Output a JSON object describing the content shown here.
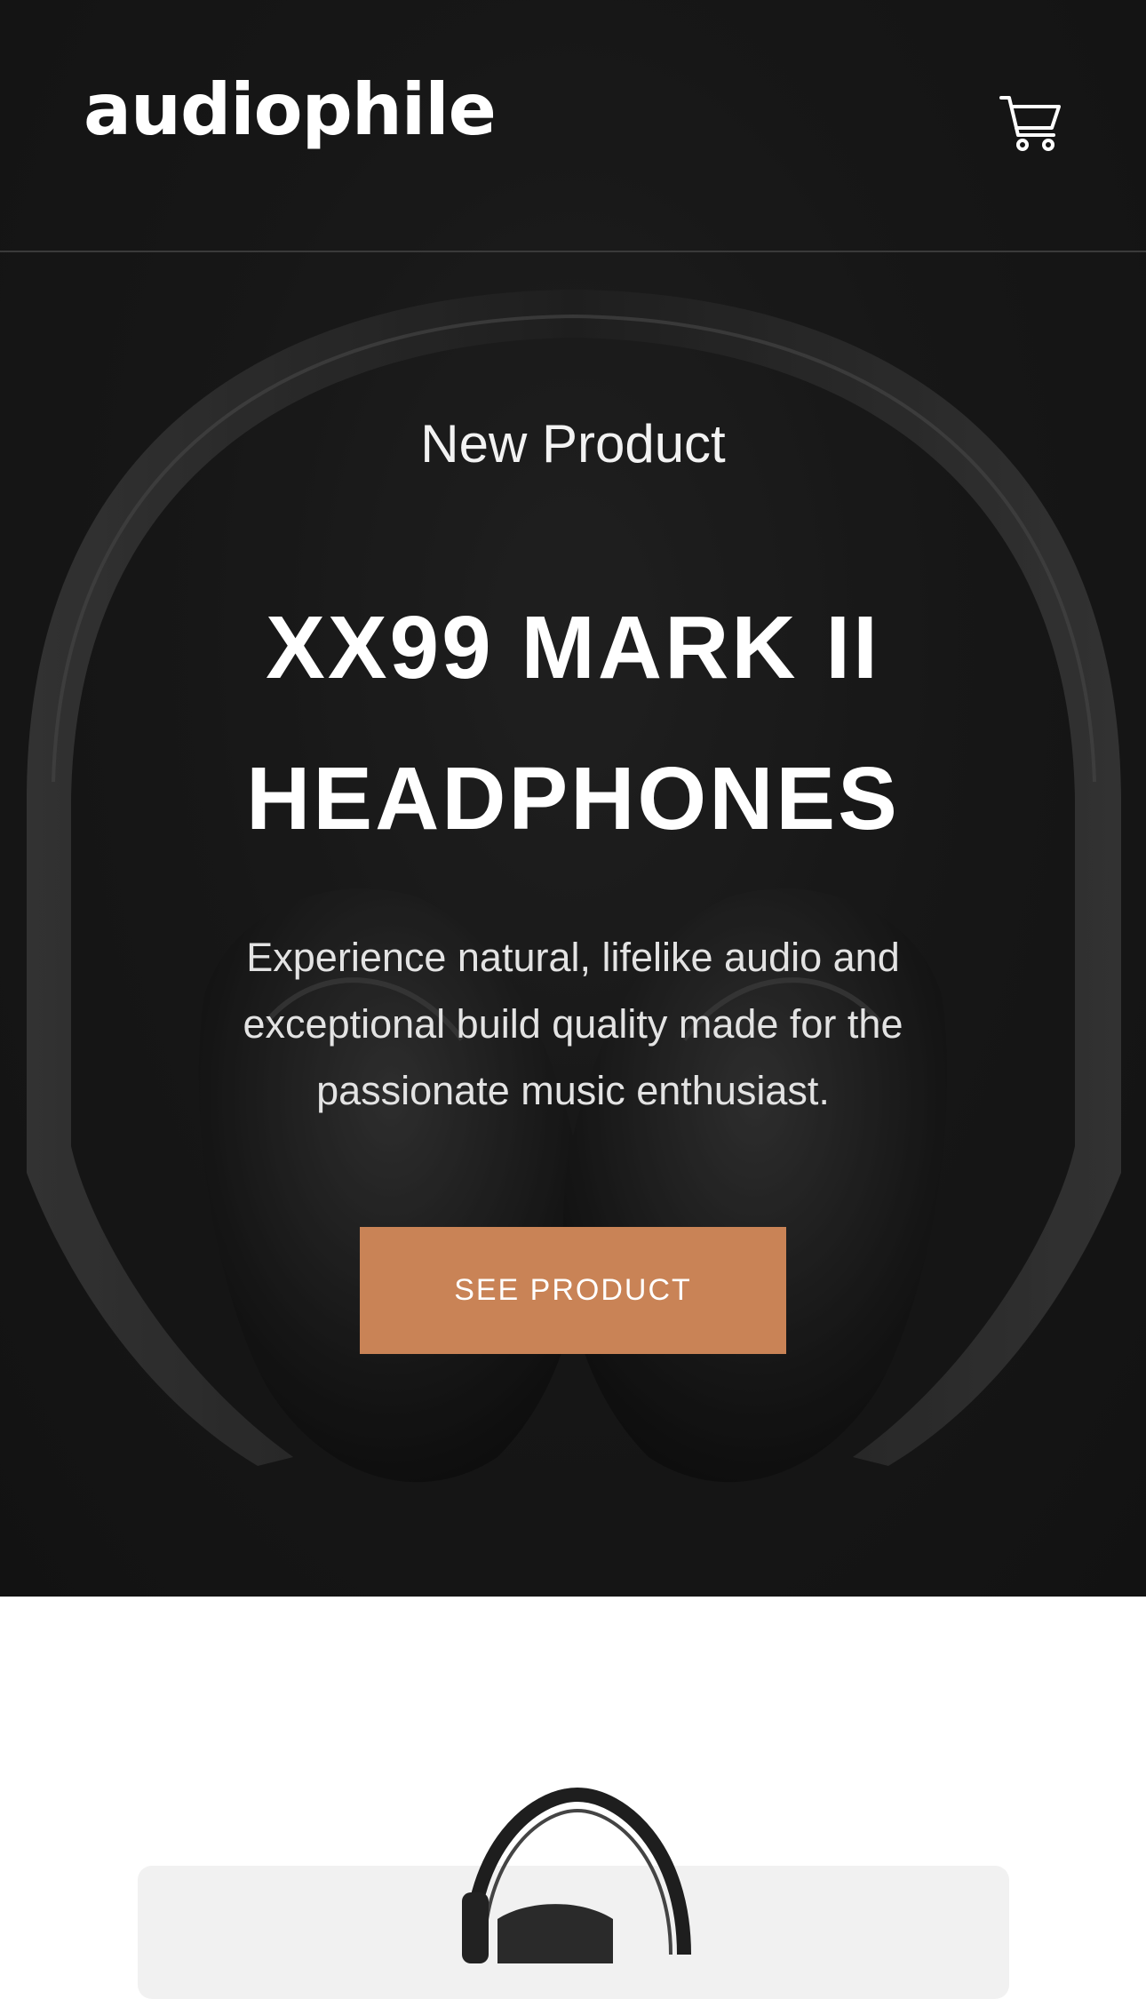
{
  "header": {
    "logo": "audiophile",
    "cart_icon": "shopping-cart-icon"
  },
  "hero": {
    "overline": "New Product",
    "title": "XX99 MARK II HEADPHONES",
    "description": "Experience natural, lifelike audio and exceptional build quality made for the passionate music enthusiast.",
    "cta_label": "SEE PRODUCT",
    "background_image": "headphones-photo"
  },
  "category": {
    "image": "headphones-product-thumbnail"
  },
  "colors": {
    "hero_background": "#191919",
    "accent": "#c98356",
    "text_light": "#ffffff",
    "card_background": "#f1f1f1"
  }
}
